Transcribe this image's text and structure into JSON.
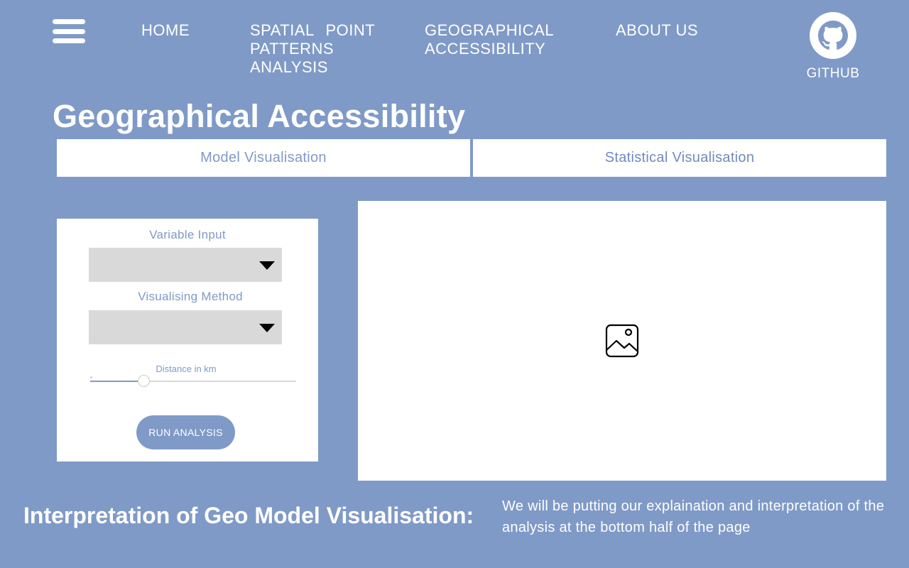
{
  "nav": {
    "menu_icon": "hamburger-menu-icon",
    "items": [
      {
        "id": "home",
        "label": "HOME"
      },
      {
        "id": "spp",
        "label": "SPATIAL POINT\nPATTERNS\nANALYSIS"
      },
      {
        "id": "geo",
        "label": "GEOGRAPHICAL\nACCESSIBILITY"
      },
      {
        "id": "about",
        "label": "ABOUT US"
      }
    ],
    "github": {
      "icon": "github-icon",
      "label": "GITHUB"
    }
  },
  "page": {
    "title": "Geographical Accessibility"
  },
  "tabs": [
    {
      "label": "Model Visualisation",
      "active": false
    },
    {
      "label": "Statistical Visualisation",
      "active": true
    }
  ],
  "controls": {
    "variable_input": {
      "label": "Variable Input",
      "value": ""
    },
    "visualising_method": {
      "label": "Visualising Method",
      "value": ""
    },
    "distance": {
      "label": "Distance in km",
      "fraction": 0.26
    },
    "run_button": "RUN ANALYSIS"
  },
  "visual": {
    "placeholder_icon": "image-placeholder-icon"
  },
  "interpretation": {
    "title": "Interpretation of Geo Model Visualisation:",
    "text": "We will be putting our explaination and interpretation of the analysis at the bottom half of the page"
  },
  "colors": {
    "background": "#7f9ac7",
    "panel": "#ffffff",
    "select": "#d9d9d9",
    "accent": "#7f9ac7"
  }
}
